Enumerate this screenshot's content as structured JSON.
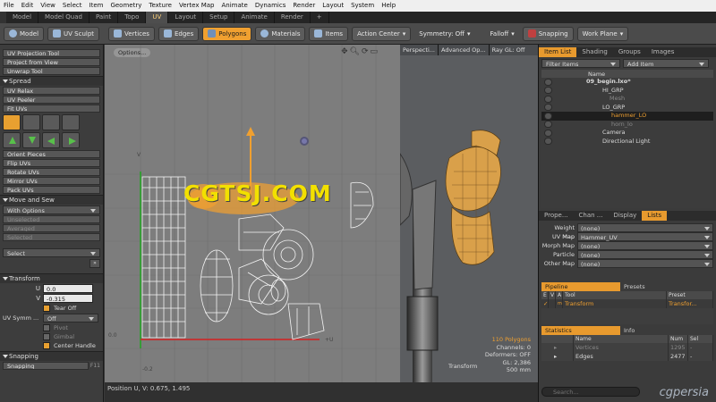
{
  "menu": [
    "File",
    "Edit",
    "View",
    "Select",
    "Item",
    "Geometry",
    "Texture",
    "Vertex Map",
    "Animate",
    "Dynamics",
    "Render",
    "Layout",
    "System",
    "Help"
  ],
  "layout_tabs": [
    "Model",
    "Model Quad",
    "Paint",
    "Topo",
    "UV",
    "Layout",
    "Setup",
    "Animate",
    "Render",
    "+"
  ],
  "active_layout_tab": "UV",
  "toolbar": {
    "model": "Model",
    "uv_sculpt": "UV Sculpt",
    "vertices": "Vertices",
    "edges": "Edges",
    "polygons": "Polygons",
    "materials": "Materials",
    "items": "Items",
    "action_center": "Action Center",
    "symmetry": "Symmetry: Off",
    "falloff": "Falloff",
    "snapping": "Snapping",
    "work_plane": "Work Plane"
  },
  "left": {
    "uv_tools": [
      "UV Projection Tool",
      "Project from View",
      "Unwrap Tool"
    ],
    "spread_header": "Spread",
    "spread_tools": [
      "UV Relax",
      "UV Peeler",
      "Fit UVs"
    ],
    "orient_tools": [
      "Orient Pieces",
      "Flip UVs",
      "Rotate UVs",
      "Mirror UVs",
      "Pack UVs"
    ],
    "move_header": "Move and Sew",
    "with_options": "With Options",
    "sew_disabled": [
      "Unselected",
      "Averaged",
      "Selected"
    ],
    "select": "Select",
    "transform_header": "Transform",
    "u_label": "U",
    "u_value": "0.0",
    "v_label": "V",
    "v_value": "-0.315",
    "tear_off": "Tear Off",
    "uv_symm_label": "UV Symm ...",
    "uv_symm_value": "Off",
    "pivot": "Pivot",
    "gimbal": "Gimbal",
    "center_handle": "Center Handle",
    "snapping_header": "Snapping",
    "snapping_btn": "Snapping",
    "snapping_key": "F11"
  },
  "uv_viewport": {
    "options": "Options...",
    "v_axis": "V",
    "u_axis": "+U",
    "origin": "0.0",
    "minus": "-0.2"
  },
  "persp_viewport": {
    "tabs": [
      "Perspecti...",
      "Advanced Op...",
      "Ray GL: Off"
    ],
    "polygons": "110 Polygons",
    "channels": "Channels: 0",
    "deformers": "Deformers: OFF",
    "gl": "GL: 2,386",
    "transform": "Transform",
    "size": "500 mm"
  },
  "watermark": "CGTSJ.COM",
  "status": "Position U, V:  0.675, 1.495",
  "right": {
    "tabs": [
      "Item List",
      "Shading",
      "Groups",
      "Images"
    ],
    "filter_items": "Filter Items",
    "add_item": "Add Item",
    "name_col": "Name",
    "tree": [
      "09_begin.lxo*",
      "HI_GRP",
      "Mesh",
      "LO_GRP",
      "hammer_LO",
      "horn_lo",
      "Camera",
      "Directional Light"
    ],
    "prop_tabs": [
      "Prope...",
      "Chan ...",
      "Display",
      "Lists"
    ],
    "props": [
      {
        "label": "Weight Map",
        "value": "(none)"
      },
      {
        "label": "UV Map",
        "value": "Hammer_UV"
      },
      {
        "label": "Morph Map",
        "value": "(none)"
      },
      {
        "label": "Particle",
        "value": "(none)"
      },
      {
        "label": "Other Map",
        "value": "(none)"
      }
    ],
    "pipeline": "Pipeline",
    "presets": "Presets",
    "pipe_cols": [
      "E",
      "V",
      "A",
      "Tool",
      "Preset"
    ],
    "pipe_row": {
      "tool": "Transform",
      "preset": "Transfor..."
    },
    "statistics": "Statistics",
    "info": "Info",
    "stat_cols": [
      "Name",
      "Num",
      "Sel"
    ],
    "stat_rows": [
      {
        "name": "Vertices",
        "num": "1295",
        "sel": "-"
      },
      {
        "name": "Edges",
        "num": "2477",
        "sel": "-"
      }
    ],
    "search_placeholder": "Search..."
  },
  "brand": "cgpersia",
  "colors": {
    "accent": "#f0a030",
    "selected_uv": "#f0a030",
    "watermark": "#f2e000"
  }
}
